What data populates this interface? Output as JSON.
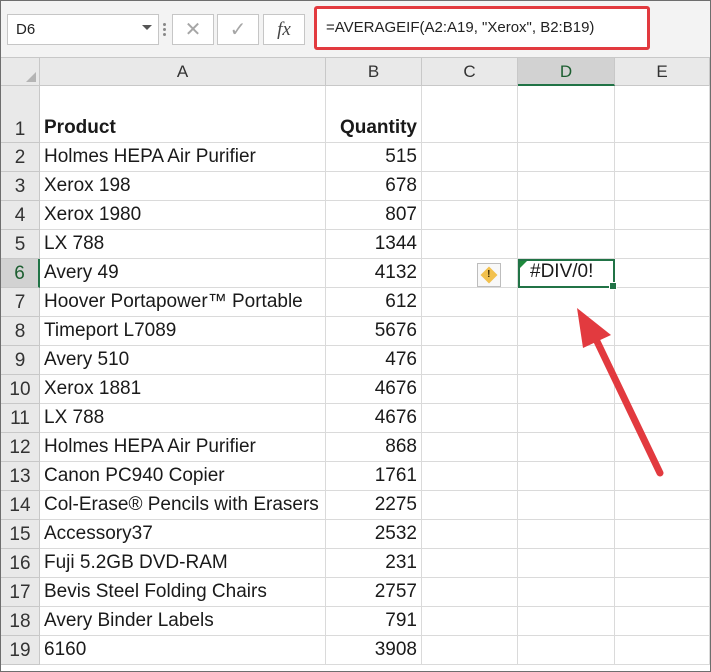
{
  "name_box": "D6",
  "formula_bar": {
    "cancel_icon": "✕",
    "enter_icon": "✓",
    "fx_label": "fx",
    "formula": "=AVERAGEIF(A2:A19, \"Xerox\", B2:B19)"
  },
  "columns": [
    "A",
    "B",
    "C",
    "D",
    "E"
  ],
  "rows": [
    "1",
    "2",
    "3",
    "4",
    "5",
    "6",
    "7",
    "8",
    "9",
    "10",
    "11",
    "12",
    "13",
    "14",
    "15",
    "16",
    "17",
    "18",
    "19"
  ],
  "headers": {
    "product": "Product",
    "quantity": "Quantity"
  },
  "data": [
    {
      "product": "Holmes HEPA Air Purifier",
      "quantity": "515"
    },
    {
      "product": "Xerox 198",
      "quantity": "678"
    },
    {
      "product": "Xerox 1980",
      "quantity": "807"
    },
    {
      "product": "LX 788",
      "quantity": "1344"
    },
    {
      "product": "Avery 49",
      "quantity": "4132"
    },
    {
      "product": "Hoover Portapower™ Portable",
      "quantity": "612"
    },
    {
      "product": "Timeport L7089",
      "quantity": "5676"
    },
    {
      "product": "Avery 510",
      "quantity": "476"
    },
    {
      "product": "Xerox 1881",
      "quantity": "4676"
    },
    {
      "product": "LX 788",
      "quantity": "4676"
    },
    {
      "product": "Holmes HEPA Air Purifier",
      "quantity": "868"
    },
    {
      "product": "Canon PC940 Copier",
      "quantity": "1761"
    },
    {
      "product": "Col-Erase® Pencils with Erasers",
      "quantity": "2275"
    },
    {
      "product": "Accessory37",
      "quantity": "2532"
    },
    {
      "product": "Fuji 5.2GB DVD-RAM",
      "quantity": "231"
    },
    {
      "product": "Bevis Steel Folding Chairs",
      "quantity": "2757"
    },
    {
      "product": "Avery Binder Labels",
      "quantity": "791"
    },
    {
      "product": "6160",
      "quantity": "3908"
    }
  ],
  "d6_value": "#DIV/0!",
  "colors": {
    "highlight": "#e23a3f",
    "selection": "#217346"
  }
}
